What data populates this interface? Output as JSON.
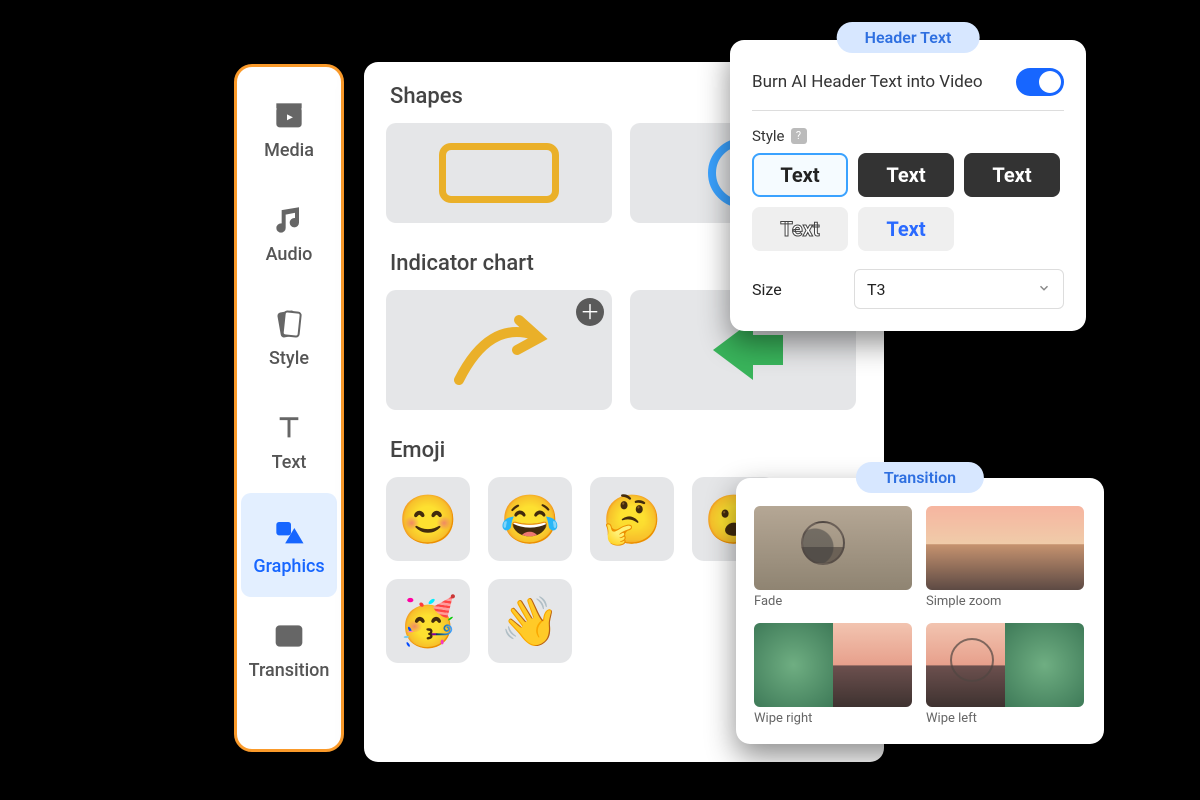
{
  "sidebar": {
    "items": [
      {
        "id": "media",
        "label": "Media",
        "active": false
      },
      {
        "id": "audio",
        "label": "Audio",
        "active": false
      },
      {
        "id": "style",
        "label": "Style",
        "active": false
      },
      {
        "id": "text",
        "label": "Text",
        "active": false
      },
      {
        "id": "graphics",
        "label": "Graphics",
        "active": true
      },
      {
        "id": "transition",
        "label": "Transition",
        "active": false
      }
    ]
  },
  "panel": {
    "shapes_title": "Shapes",
    "indicator_title": "Indicator chart",
    "emoji_title": "Emoji",
    "emoji": [
      "😊",
      "😂",
      "🤔",
      "😮",
      "🥳",
      "👋"
    ]
  },
  "header_panel": {
    "title": "Header Text",
    "toggle_label": "Burn AI Header Text into Video",
    "toggle_on": true,
    "style_label": "Style",
    "style_options": [
      "Text",
      "Text",
      "Text",
      "Text",
      "Text"
    ],
    "style_selected_index": 0,
    "size_label": "Size",
    "size_value": "T3"
  },
  "transition_panel": {
    "title": "Transition",
    "items": [
      {
        "id": "fade",
        "label": "Fade"
      },
      {
        "id": "simple_zoom",
        "label": "Simple zoom"
      },
      {
        "id": "wipe_right",
        "label": "Wipe right"
      },
      {
        "id": "wipe_left",
        "label": "Wipe left"
      }
    ]
  }
}
